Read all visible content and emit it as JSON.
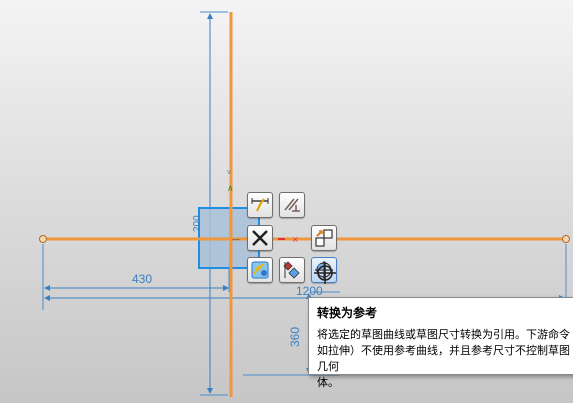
{
  "dimensions": {
    "width_label": "430",
    "length_label": "1200",
    "height_label": "360",
    "box_label": "200"
  },
  "radial_toolbar": {
    "buttons": [
      {
        "name": "quick-trim-button",
        "icon": "quick-trim-icon"
      },
      {
        "name": "perpendicular-constraint-button",
        "icon": "perpendicular-icon"
      },
      {
        "name": "delete-button",
        "icon": "delete-icon"
      },
      {
        "name": "convert-to-reference-button",
        "icon": "convert-reference-icon"
      },
      {
        "name": "make-symmetric-button",
        "icon": "symmetric-icon"
      },
      {
        "name": "show-constraints-button",
        "icon": "show-constraints-icon"
      },
      {
        "name": "continuous-auto-dimension-button",
        "icon": "auto-dimension-icon"
      }
    ]
  },
  "tooltip": {
    "title": "转换为参考",
    "body": "将选定的草图曲线或草图尺寸转换为引用。下游命令\n如拉伸）不使用参考曲线，并且参考尺寸不控制草图几何\n体。"
  },
  "colors": {
    "sketch_line": "#f0963c",
    "dimension": "#3a7fc4",
    "profile": "#1e8fe0",
    "tooltip_bg": "#ffffff"
  }
}
